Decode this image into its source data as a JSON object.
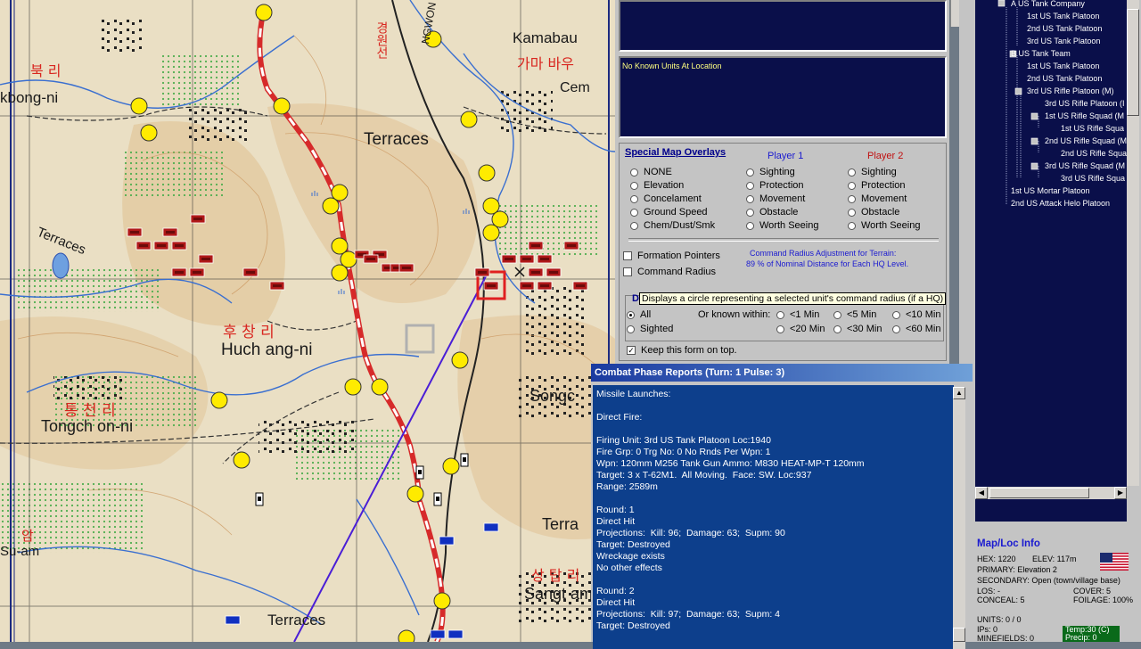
{
  "map": {
    "labels": {
      "kamabau": "Kamabau",
      "kamabau_kr": "가마 바우",
      "cem": "Cem",
      "kbong": "kbong-ni",
      "kr_north": "북 리",
      "terraces_top": "Terraces",
      "terraces_left": "Terraces",
      "kr_hu": "후 창 리",
      "huchang": "Huch ang-ni",
      "kr_tong": "통 천 리",
      "tongch": "Tongch on-ni",
      "songc": "Songc",
      "terra": "Terra",
      "kr_sang": "상 탑 리",
      "sangt": "Sangt am",
      "suam": "Su-am",
      "kr_am": "암",
      "terraces_bottom": "Terraces",
      "road_label": "NGWON SON",
      "road_label_kr": "경원선"
    }
  },
  "location_panel": {
    "text": "No Known Units At Location"
  },
  "overlays": {
    "title": "Special Map Overlays",
    "player1": "Player 1",
    "player2": "Player 2",
    "col1": [
      "NONE",
      "Elevation",
      "Concelament",
      "Ground Speed",
      "Chem/Dust/Smk"
    ],
    "col2": [
      "Sighting",
      "Protection",
      "Movement",
      "Obstacle",
      "Worth Seeing"
    ],
    "col3": [
      "Sighting",
      "Protection",
      "Movement",
      "Obstacle",
      "Worth Seeing"
    ],
    "formation_pointers": "Formation Pointers",
    "command_radius": "Command Radius",
    "cmd_note_line1": "Command Radius Adjustment for Terrain:",
    "cmd_note_line2": "89 % of Nominal Distance for Each HQ Level.",
    "display_label": "D",
    "tooltip": "Displays a circle representing a selected unit's command radius (if a HQ)",
    "all": "All",
    "sighted": "Sighted",
    "known_within": "Or known within:",
    "times": [
      "<1 Min",
      "<5 Min",
      "<10 Min",
      "<20 Min",
      "<30 Min",
      "<60 Min"
    ],
    "keep_on_top": "Keep this form on top."
  },
  "tree": {
    "items": [
      "A  US Tank Company",
      "1st US Tank Platoon",
      "2nd US Tank Platoon",
      "3rd US Tank Platoon",
      "B  US Tank Team",
      "1st US Tank Platoon",
      "2nd US Tank Platoon",
      "3rd US Rifle Platoon (M)",
      "3rd US Rifle Platoon (I",
      "1st US Rifle Squad (M",
      "1st US Rifle Squa",
      "2nd US Rifle Squad (M",
      "2nd US Rifle Squa",
      "3rd US Rifle Squad (M",
      "3rd US Rifle Squa",
      "1st US Mortar Platoon",
      "2nd US Attack Helo Platoon"
    ]
  },
  "reports": {
    "title": "Combat Phase Reports  (Turn: 1  Pulse: 3)",
    "body": "Missile Launches:\n\nDirect Fire:\n\nFiring Unit: 3rd US Tank Platoon Loc:1940\nFire Grp: 0 Trg No: 0 No Rnds Per Wpn: 1\nWpn: 120mm M256 Tank Gun Ammo: M830 HEAT-MP-T 120mm\nTarget: 3 x T-62M1.  All Moving.  Face: SW. Loc:937\nRange: 2589m\n\nRound: 1\nDirect Hit\nProjections:  Kill: 96;  Damage: 63;  Supm: 90\nTarget: Destroyed\nWreckage exists\nNo other effects\n\nRound: 2\nDirect Hit\nProjections:  Kill: 97;  Damage: 63;  Supm: 4\nTarget: Destroyed"
  },
  "mapinfo": {
    "title": "Map/Loc Info",
    "hex": "HEX: 1220",
    "elev": "ELEV:  117m",
    "primary": "PRIMARY: Elevation 2",
    "secondary": "SECONDARY: Open (town/village base)",
    "los": "LOS: -",
    "cover": "COVER: 5",
    "conceal": "CONCEAL: 5",
    "foilage": "FOILAGE: 100%",
    "units": "UNITS: 0 / 0",
    "ips": "IPs: 0",
    "minefields": "MINEFIELDS: 0",
    "temp": "Temp:30 (C)",
    "precip": "Precip: 0"
  },
  "colors": {
    "navy": "#0a0f4a",
    "report_bg": "#0d3f8c",
    "enemy_red": "#b01818",
    "friendly_blue": "#1030c0",
    "marker_yellow": "#ffeb00",
    "player1": "#1a1ad0",
    "player2": "#c01010"
  }
}
